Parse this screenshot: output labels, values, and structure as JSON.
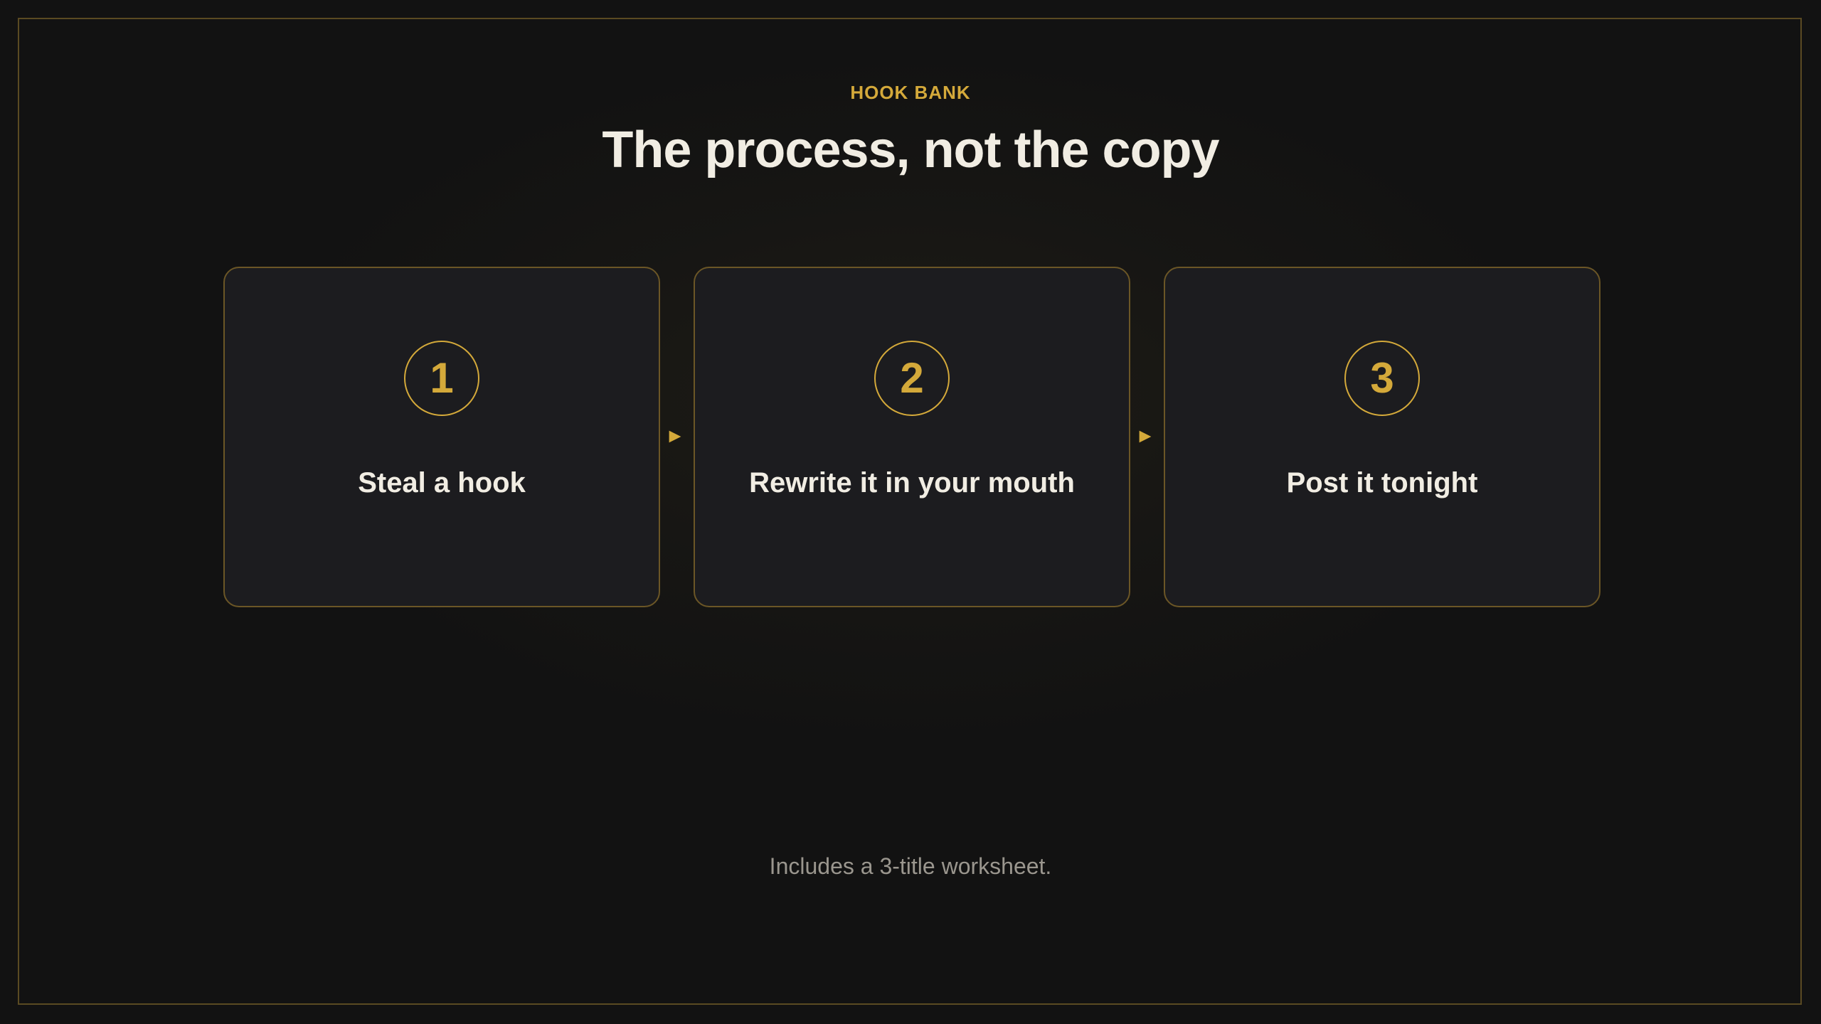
{
  "header": {
    "eyebrow": "HOOK BANK",
    "title": "The process, not the copy"
  },
  "steps": [
    {
      "number": "1",
      "label": "Steal a hook"
    },
    {
      "number": "2",
      "label": "Rewrite it in your mouth"
    },
    {
      "number": "3",
      "label": "Post it tonight"
    }
  ],
  "arrows": [
    "►",
    "►"
  ],
  "footnote": "Includes a 3-title worksheet.",
  "colors": {
    "accent": "#d4a93a",
    "background": "#121212",
    "card": "#1c1c1f",
    "text": "#f1ede3",
    "muted": "#9a968e"
  }
}
